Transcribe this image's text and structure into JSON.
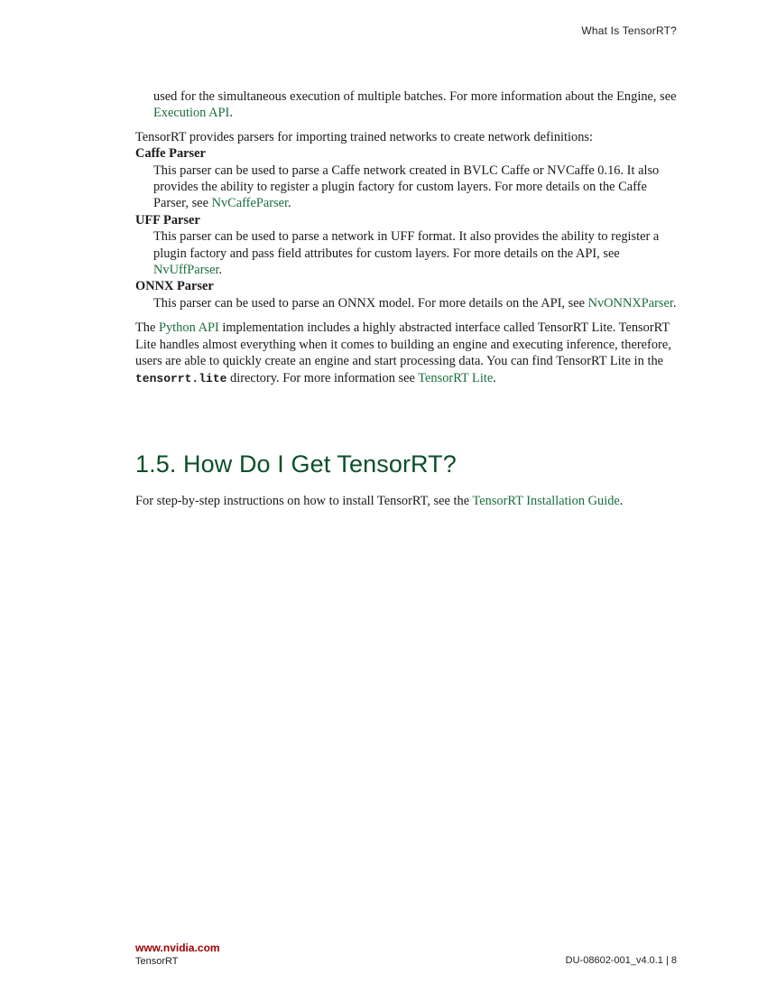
{
  "header": {
    "running_title": "What Is TensorRT?"
  },
  "intro": {
    "cont_text": "used for the simultaneous execution of multiple batches. For more information about the Engine, see ",
    "cont_link": "Execution API",
    "cont_end": "."
  },
  "parsers": {
    "lead": "TensorRT provides parsers for importing trained networks to create network definitions:",
    "items": [
      {
        "term": "Caffe Parser",
        "text": "This parser can be used to parse a Caffe network created in BVLC Caffe or NVCaffe 0.16. It also provides the ability to register a plugin factory for custom layers. For more details on the Caffe Parser, see ",
        "link": "NvCaffeParser",
        "end": "."
      },
      {
        "term": "UFF Parser",
        "text": "This parser can be used to parse a network in UFF format. It also provides the ability to register a plugin factory and pass field attributes for custom layers. For more details on the API, see ",
        "link": "NvUffParser",
        "end": "."
      },
      {
        "term": "ONNX Parser",
        "text": "This parser can be used to parse an ONNX model. For more details on the API, see ",
        "link": "NvONNXParser",
        "end": "."
      }
    ]
  },
  "python": {
    "t1": "The ",
    "link1": "Python API",
    "t2": " implementation includes a highly abstracted interface called TensorRT Lite. TensorRT Lite handles almost everything when it comes to building an engine and executing inference, therefore, users are able to quickly create an engine and start processing data. You can find TensorRT Lite in the ",
    "code": "tensorrt.lite",
    "t3": " directory. For more information see ",
    "link2": "TensorRT Lite",
    "t4": "."
  },
  "section": {
    "heading": "1.5. How Do I Get TensorRT?",
    "t1": "For step-by-step instructions on how to install TensorRT, see the ",
    "link": "TensorRT Installation Guide",
    "t2": "."
  },
  "footer": {
    "url": "www.nvidia.com",
    "product": "TensorRT",
    "doc_id": "DU-08602-001_v4.0.1 | 8"
  },
  "colors": {
    "link": "#1a6e3d",
    "heading": "#0b4f2a",
    "footer_url": "#a00000"
  }
}
